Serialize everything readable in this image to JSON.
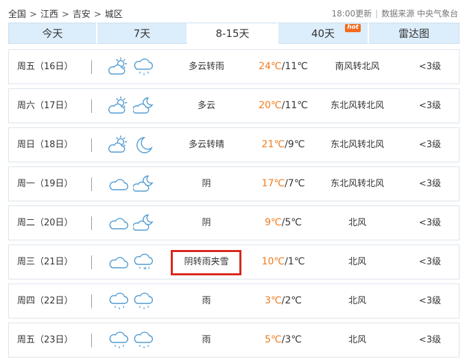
{
  "breadcrumb": {
    "items": [
      "全国",
      "江西",
      "吉安",
      "城区"
    ],
    "separator": ">"
  },
  "update": {
    "time": "18:00更新",
    "source": "数据来源 中央气象台"
  },
  "tabs": [
    {
      "label": "今天",
      "active": false
    },
    {
      "label": "7天",
      "active": false
    },
    {
      "label": "8-15天",
      "active": true
    },
    {
      "label": "40天",
      "active": false,
      "badge": "hot"
    },
    {
      "label": "雷达图",
      "active": false
    }
  ],
  "colors": {
    "accent": "#4d9ad2",
    "tab_bg": "#dcedfb",
    "high_temp": "#f07a1a",
    "highlight_border": "#d9261c",
    "hot_badge": "#f36c21"
  },
  "forecast": [
    {
      "day": "周五（16日）",
      "icon1": "partly-cloudy-day-icon",
      "icon2": "rain-icon",
      "condition": "多云转雨",
      "high": "24℃",
      "low": "/11℃",
      "wind": "南风转北风",
      "level": "<3级"
    },
    {
      "day": "周六（17日）",
      "icon1": "partly-cloudy-day-icon",
      "icon2": "partly-cloudy-night-icon",
      "condition": "多云",
      "high": "20℃",
      "low": "/11℃",
      "wind": "东北风转北风",
      "level": "<3级"
    },
    {
      "day": "周日（18日）",
      "icon1": "partly-cloudy-day-icon",
      "icon2": "clear-night-icon",
      "condition": "多云转晴",
      "high": "21℃",
      "low": "/9℃",
      "wind": "东北风转北风",
      "level": "<3级"
    },
    {
      "day": "周一（19日）",
      "icon1": "overcast-icon",
      "icon2": "partly-cloudy-night-icon",
      "condition": "阴",
      "high": "17℃",
      "low": "/7℃",
      "wind": "东北风转北风",
      "level": "<3级"
    },
    {
      "day": "周二（20日）",
      "icon1": "overcast-icon",
      "icon2": "partly-cloudy-night-icon",
      "condition": "阴",
      "high": "9℃",
      "low": "/5℃",
      "wind": "北风",
      "level": "<3级"
    },
    {
      "day": "周三（21日）",
      "icon1": "overcast-icon",
      "icon2": "sleet-icon",
      "condition": "阴转雨夹雪",
      "high": "10℃",
      "low": "/1℃",
      "wind": "北风",
      "level": "<3级",
      "highlighted": true
    },
    {
      "day": "周四（22日）",
      "icon1": "rain-icon",
      "icon2": "rain-icon",
      "condition": "雨",
      "high": "3℃",
      "low": "/2℃",
      "wind": "北风",
      "level": "<3级"
    },
    {
      "day": "周五（23日）",
      "icon1": "rain-icon",
      "icon2": "rain-icon",
      "condition": "雨",
      "high": "5℃",
      "low": "/3℃",
      "wind": "北风",
      "level": "<3级"
    }
  ]
}
